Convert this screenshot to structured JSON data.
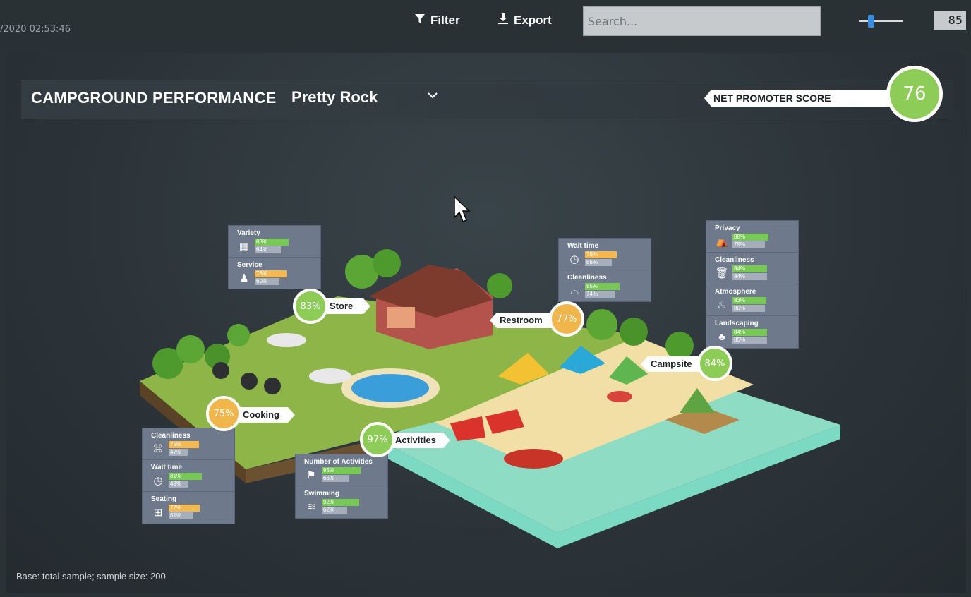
{
  "toolbar": {
    "timestamp": "/2020 02:53:46",
    "filter_label": "Filter",
    "export_label": "Export",
    "search_placeholder": "Search...",
    "slider_value": 85,
    "number_value": "85"
  },
  "header": {
    "title": "CAMPGROUND PERFORMANCE",
    "site": "Pretty Rock",
    "nps_label": "NET PROMOTER SCORE",
    "nps_value": "76"
  },
  "areas": {
    "store": {
      "label": "Store",
      "score": "83%",
      "color": "green"
    },
    "restroom": {
      "label": "Restroom",
      "score": "77%",
      "color": "orange"
    },
    "campsite": {
      "label": "Campsite",
      "score": "84%",
      "color": "green"
    },
    "cooking": {
      "label": "Cooking",
      "score": "75%",
      "color": "orange"
    },
    "activities": {
      "label": "Activities",
      "score": "97%",
      "color": "green"
    }
  },
  "boxes": {
    "store": [
      {
        "name": "Variety",
        "icon": "store-icon",
        "top": "83%",
        "top_color": "green",
        "bottom": "64%"
      },
      {
        "name": "Service",
        "icon": "service-icon",
        "top": "78%",
        "top_color": "orange",
        "bottom": "60%"
      }
    ],
    "restroom": [
      {
        "name": "Wait time",
        "icon": "clock-icon",
        "top": "78%",
        "top_color": "orange",
        "bottom": "66%"
      },
      {
        "name": "Cleanliness",
        "icon": "cleaning-icon",
        "top": "85%",
        "top_color": "green",
        "bottom": "74%"
      }
    ],
    "campsite": [
      {
        "name": "Privacy",
        "icon": "tent-icon",
        "top": "88%",
        "top_color": "green",
        "bottom": "79%"
      },
      {
        "name": "Cleanliness",
        "icon": "trash-icon",
        "top": "84%",
        "top_color": "green",
        "bottom": "84%"
      },
      {
        "name": "Atmosphere",
        "icon": "campfire-icon",
        "top": "83%",
        "top_color": "green",
        "bottom": "80%"
      },
      {
        "name": "Landscaping",
        "icon": "tree-icon",
        "top": "84%",
        "top_color": "green",
        "bottom": "85%"
      }
    ],
    "cooking": [
      {
        "name": "Cleanliness",
        "icon": "grill-icon",
        "top": "75%",
        "top_color": "orange",
        "bottom": "47%"
      },
      {
        "name": "Wait time",
        "icon": "clock-icon",
        "top": "81%",
        "top_color": "green",
        "bottom": "49%"
      },
      {
        "name": "Seating",
        "icon": "seating-icon",
        "top": "77%",
        "top_color": "orange",
        "bottom": "61%"
      }
    ],
    "activities": [
      {
        "name": "Number of Activities",
        "icon": "activities-icon",
        "top": "95%",
        "top_color": "green",
        "bottom": "66%"
      },
      {
        "name": "Swimming",
        "icon": "pool-icon",
        "top": "92%",
        "top_color": "green",
        "bottom": "62%"
      }
    ]
  },
  "footer": {
    "base": "Base: total sample; sample size: 200"
  },
  "colors": {
    "green": "#8ccc57",
    "orange": "#f0b64c",
    "panel": "#2b3338",
    "box": "#6e7a8c"
  }
}
